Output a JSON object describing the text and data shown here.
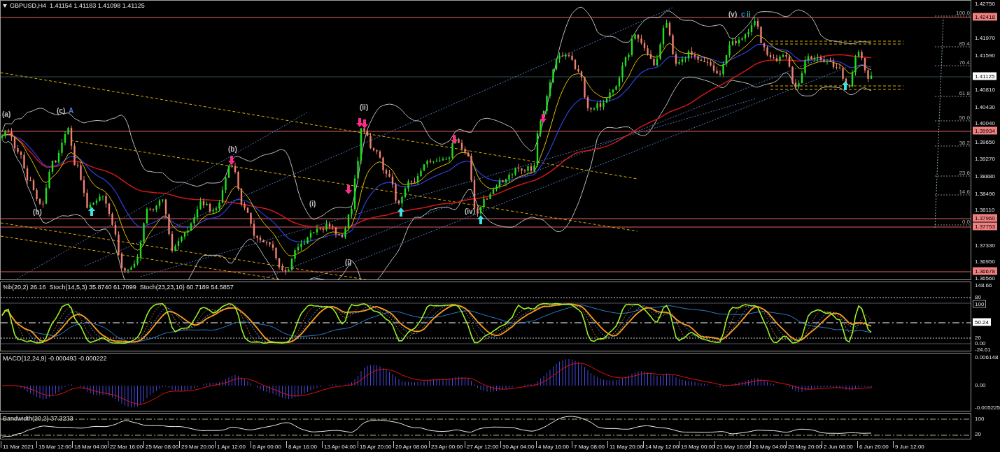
{
  "header": {
    "title": "GBPUSD,H4  1.41154 1.41183 1.41098 1.41125"
  },
  "price_axis": {
    "ticks": [
      "1.42750",
      "1.41970",
      "1.41590",
      "1.40810",
      "1.40430",
      "1.40040",
      "1.39650",
      "1.39270",
      "1.38880",
      "1.38490",
      "1.38110",
      "1.37330",
      "1.36950",
      "1.36560"
    ],
    "tags": [
      {
        "text": "1.42418",
        "kind": "level"
      },
      {
        "text": "1.41125",
        "kind": "current"
      },
      {
        "text": "1.39934",
        "kind": "level"
      },
      {
        "text": "1.37960",
        "kind": "level"
      },
      {
        "text": "1.37753",
        "kind": "level"
      },
      {
        "text": "1.36678",
        "kind": "level"
      }
    ]
  },
  "wave_labels": [
    {
      "text": "(a)",
      "color": "#c0c0c0"
    },
    {
      "text": "(c)",
      "color": "#c0c0c0"
    },
    {
      "text": "A",
      "color": "#4a7bd8"
    },
    {
      "text": "(b)",
      "color": "#c0c0c0"
    },
    {
      "text": "(b)",
      "color": "#c0c0c0"
    },
    {
      "text": "(i)",
      "color": "#c0c0c0"
    },
    {
      "text": "(i)",
      "color": "#c0c0c0"
    },
    {
      "text": "(ii)",
      "color": "#c0c0c0"
    },
    {
      "text": "(iv)",
      "color": "#c0c0c0"
    },
    {
      "text": "(v)",
      "color": "#c0c0c0"
    },
    {
      "text": "c",
      "color": "#4a7bd8"
    },
    {
      "text": "ii",
      "color": "#27b5b5"
    }
  ],
  "fib_levels": [
    "100.0",
    "85.4",
    "76.4",
    "61.8",
    "50.0",
    "38.2",
    "23.6",
    "14.6",
    "0.0"
  ],
  "stochastic": {
    "label": "%b(20,2) 26.16  Stoch(14,5,3) 35.8740 61.7099  Stoch(23,23,10) 60.7189 54.5857",
    "axis": [
      {
        "text": "148.66",
        "kind": "plain"
      },
      {
        "text": "80",
        "kind": "plain"
      },
      {
        "text": "100",
        "kind": "boxed"
      },
      {
        "text": "50.24",
        "kind": "current"
      },
      {
        "text": "20",
        "kind": "plain"
      },
      {
        "text": "0.00",
        "kind": "plain"
      },
      {
        "text": "-24.61",
        "kind": "plain"
      }
    ]
  },
  "macd": {
    "label": "MACD(12,24,9) -0.000493 -0.000222",
    "axis": [
      {
        "text": "0.006148"
      },
      {
        "text": "0.00"
      },
      {
        "text": "-0.005225"
      }
    ]
  },
  "bandwidth": {
    "label": "Bandwidth(20,2) 37.3233",
    "axis": [
      {
        "text": "100"
      },
      {
        "text": "20"
      }
    ]
  },
  "time_axis": [
    "11 Mar 2021",
    "15 Mar 12:00",
    "18 Mar 04:00",
    "22 Mar 16:00",
    "25 Mar 08:00",
    "29 Mar 20:00",
    "1 Apr 12:00",
    "6 Apr 00:00",
    "8 Apr 16:00",
    "13 Apr 04:00",
    "15 Apr 20:00",
    "20 Apr 08:00",
    "23 Apr 00:00",
    "27 Apr 12:00",
    "30 Apr 04:00",
    "4 May 16:00",
    "7 May 08:00",
    "11 May 20:00",
    "14 May 12:00",
    "19 May 00:00",
    "21 May 16:00",
    "26 May 04:00",
    "28 May 20:00",
    "2 Jun 08:00",
    "6 Jun 20:00",
    "9 Jun 12:00"
  ]
}
